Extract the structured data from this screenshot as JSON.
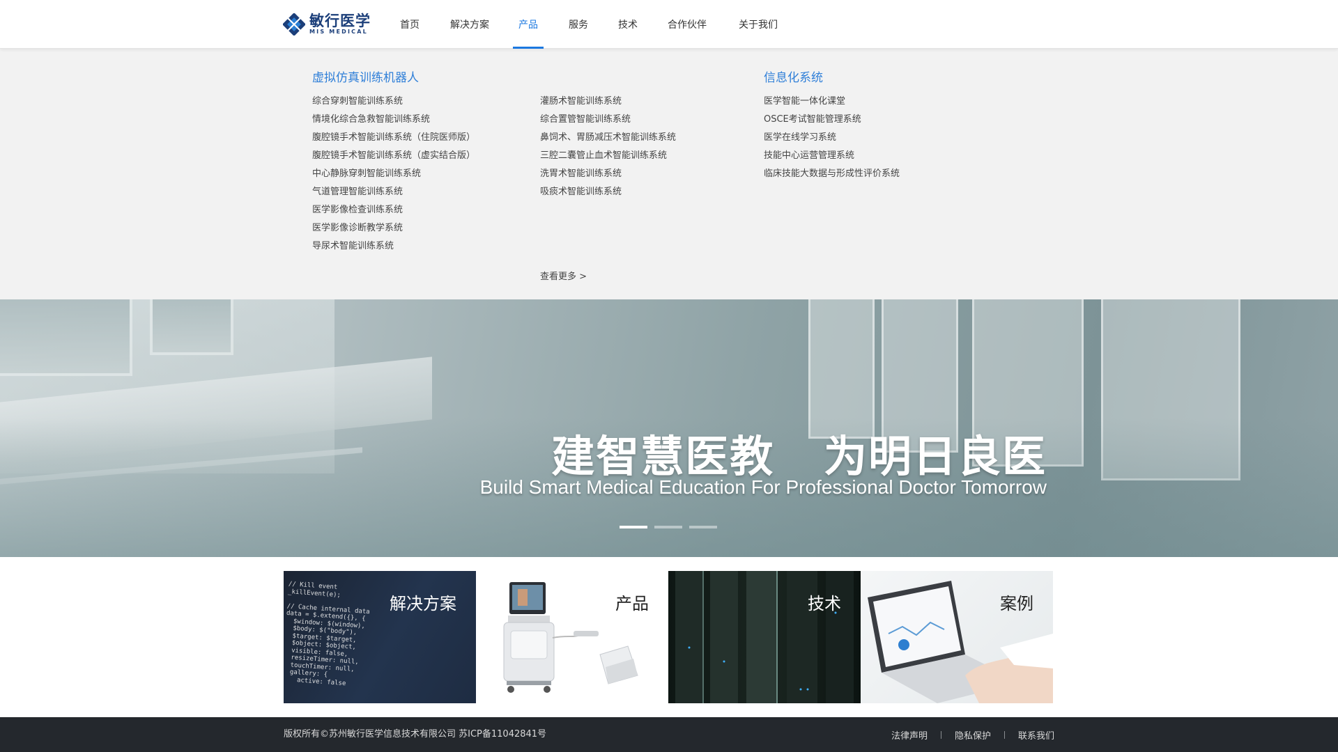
{
  "brand": {
    "name_cn": "敏行医学",
    "name_en": "MIS MEDICAL",
    "colors": {
      "primary": "#1b78e0",
      "logo": "#1c3f7a"
    }
  },
  "nav": {
    "items": [
      {
        "label": "首页"
      },
      {
        "label": "解决方案"
      },
      {
        "label": "产品",
        "active": true
      },
      {
        "label": "服务"
      },
      {
        "label": "技术"
      },
      {
        "label": "合作伙伴"
      },
      {
        "label": "关于我们"
      }
    ]
  },
  "dropdown": {
    "col1": {
      "title": "虚拟仿真训练机器人",
      "items": [
        "综合穿刺智能训练系统",
        "情境化综合急救智能训练系统",
        "腹腔镜手术智能训练系统（住院医师版）",
        "腹腔镜手术智能训练系统（虚实结合版）",
        "中心静脉穿刺智能训练系统",
        "气道管理智能训练系统",
        "医学影像检查训练系统",
        "医学影像诊断教学系统",
        "导尿术智能训练系统"
      ]
    },
    "col2": {
      "items": [
        "灌肠术智能训练系统",
        "综合置管智能训练系统",
        "鼻饲术、胃肠减压术智能训练系统",
        "三腔二囊管止血术智能训练系统",
        "洗胃术智能训练系统",
        "吸痰术智能训练系统"
      ]
    },
    "col3": {
      "title": "信息化系统",
      "items": [
        "医学智能一体化课堂",
        "OSCE考试智能管理系统",
        "医学在线学习系统",
        "技能中心运营管理系统",
        "临床技能大数据与形成性评价系统"
      ]
    },
    "more": "查看更多 >"
  },
  "banner": {
    "title": "建智慧医教   为明日良医",
    "subtitle": "Build Smart Medical Education For Professional Doctor Tomorrow",
    "slide_count": 3,
    "active_slide": 1
  },
  "cards": [
    {
      "label": "解决方案"
    },
    {
      "label": "产品"
    },
    {
      "label": "技术"
    },
    {
      "label": "案例"
    }
  ],
  "card1_code": "// Kill event\n_killEvent(e);\n\n// Cache internal data\ndata = $.extend({}, {\n  $window: $(window),\n  $body: $(\"body\"),\n  $target: $target,\n  $object: $object,\n  visible: false,\n  resizeTimer: null,\n  touchTimer: null,\n  gallery: {\n    active: false",
  "footer": {
    "copyright": "版权所有©苏州敏行医学信息技术有限公司  苏ICP备11042841号",
    "links": [
      "法律声明",
      "隐私保护",
      "联系我们"
    ]
  }
}
